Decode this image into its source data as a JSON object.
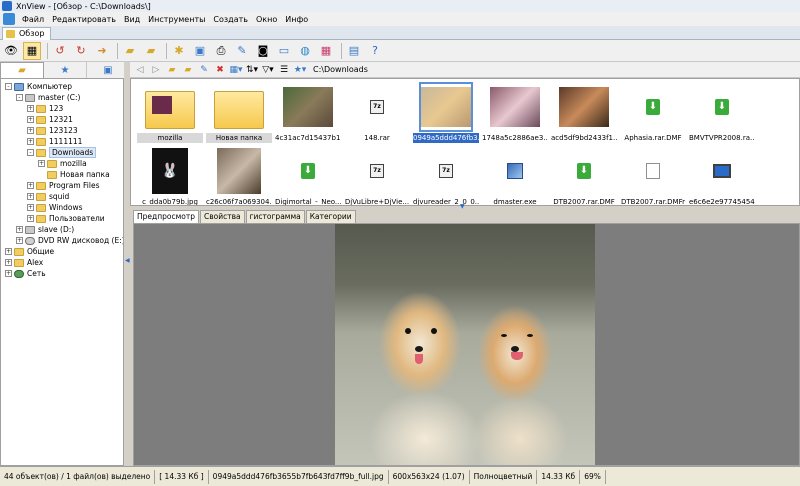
{
  "window": {
    "title": "XnView - [Обзор - C:\\Downloads\\]"
  },
  "menu": {
    "items": [
      "Файл",
      "Редактировать",
      "Вид",
      "Инструменты",
      "Создать",
      "Окно",
      "Инфо"
    ]
  },
  "tab": {
    "label": "Обзор"
  },
  "toolbar": {
    "icons": [
      "eye-icon",
      "browse-icon",
      "rotate-left-icon",
      "rotate-right-icon",
      "arrow-back-icon",
      "folder-open-icon",
      "folder-star-icon",
      "settings-icon",
      "multiview-icon",
      "print-icon",
      "scanner-icon",
      "camera-icon",
      "slideshow-icon",
      "globe-icon",
      "color-icon",
      "layout-icon",
      "help-icon"
    ]
  },
  "address": {
    "path": "C:\\Downloads"
  },
  "tree": {
    "items": [
      {
        "label": "Компьютер",
        "depth": 0,
        "icon": "pc",
        "exp": "-"
      },
      {
        "label": "master (C:)",
        "depth": 1,
        "icon": "drive",
        "exp": "-"
      },
      {
        "label": "123",
        "depth": 2,
        "icon": "folder",
        "exp": "+"
      },
      {
        "label": "12321",
        "depth": 2,
        "icon": "folder",
        "exp": "+"
      },
      {
        "label": "123123",
        "depth": 2,
        "icon": "folder",
        "exp": "+"
      },
      {
        "label": "1111111",
        "depth": 2,
        "icon": "folder",
        "exp": "+"
      },
      {
        "label": "Downloads",
        "depth": 2,
        "icon": "folder",
        "exp": "-",
        "selected": true
      },
      {
        "label": "mozilla",
        "depth": 3,
        "icon": "folder",
        "exp": "+"
      },
      {
        "label": "Новая папка",
        "depth": 3,
        "icon": "folder",
        "exp": ""
      },
      {
        "label": "Program Files",
        "depth": 2,
        "icon": "folder",
        "exp": "+"
      },
      {
        "label": "squid",
        "depth": 2,
        "icon": "folder",
        "exp": "+"
      },
      {
        "label": "Windows",
        "depth": 2,
        "icon": "folder",
        "exp": "+"
      },
      {
        "label": "Пользователи",
        "depth": 2,
        "icon": "folder",
        "exp": "+"
      },
      {
        "label": "slave (D:)",
        "depth": 1,
        "icon": "drive",
        "exp": "+"
      },
      {
        "label": "DVD RW дисковод (E:)",
        "depth": 1,
        "icon": "dvd",
        "exp": "+"
      },
      {
        "label": "Общие",
        "depth": 0,
        "icon": "folder",
        "exp": "+"
      },
      {
        "label": "Alex",
        "depth": 0,
        "icon": "folder",
        "exp": "+"
      },
      {
        "label": "Сеть",
        "depth": 0,
        "icon": "netw",
        "exp": "+"
      }
    ]
  },
  "files": [
    {
      "name": "mozilla",
      "kind": "folder-mozilla"
    },
    {
      "name": "Новая папка",
      "kind": "folder"
    },
    {
      "name": "4c31ac7d15437b1...",
      "kind": "p-monkey"
    },
    {
      "name": "148.rar",
      "kind": "rar"
    },
    {
      "name": "0949a5ddd476fb3...",
      "kind": "p-dogs",
      "selected": true
    },
    {
      "name": "1748a5c2886ae3...",
      "kind": "p-baby"
    },
    {
      "name": "acd5df9bd2433f1...",
      "kind": "p-group"
    },
    {
      "name": "Aphasia.rar.DMF",
      "kind": "dmf"
    },
    {
      "name": "BMVTVPR2008.ra...",
      "kind": "dmf"
    },
    {
      "name": "c_dda0b79b.jpg",
      "kind": "p-playboy"
    },
    {
      "name": "c26c06f7a069304...",
      "kind": "p-man"
    },
    {
      "name": "Digimortal_-_Neo...",
      "kind": "dmf"
    },
    {
      "name": "DjVuLibre+DjVie...",
      "kind": "rar"
    },
    {
      "name": "djvureader_2_0_0...",
      "kind": "rar"
    },
    {
      "name": "dmaster.exe",
      "kind": "exe"
    },
    {
      "name": "DTB2007.rar.DMF",
      "kind": "dmf"
    },
    {
      "name": "DTB2007.rar.DMFr",
      "kind": "blank"
    },
    {
      "name": "e6c6e2e97745454...",
      "kind": "mon"
    }
  ],
  "preview_tabs": [
    "Предпросмотр",
    "Свойства",
    "гистограмма",
    "Категории"
  ],
  "status": {
    "count": "44 объект(ов) / 1 файл(ов) выделено",
    "size": "[ 14.33 Кб ]",
    "filename": "0949a5ddd476fb3655b7fb643fd7ff9b_full.jpg",
    "dims": "600x563x24 (1.07)",
    "color": "Полноцветный",
    "filesize": "14.33 Кб",
    "zoom": "69%"
  }
}
